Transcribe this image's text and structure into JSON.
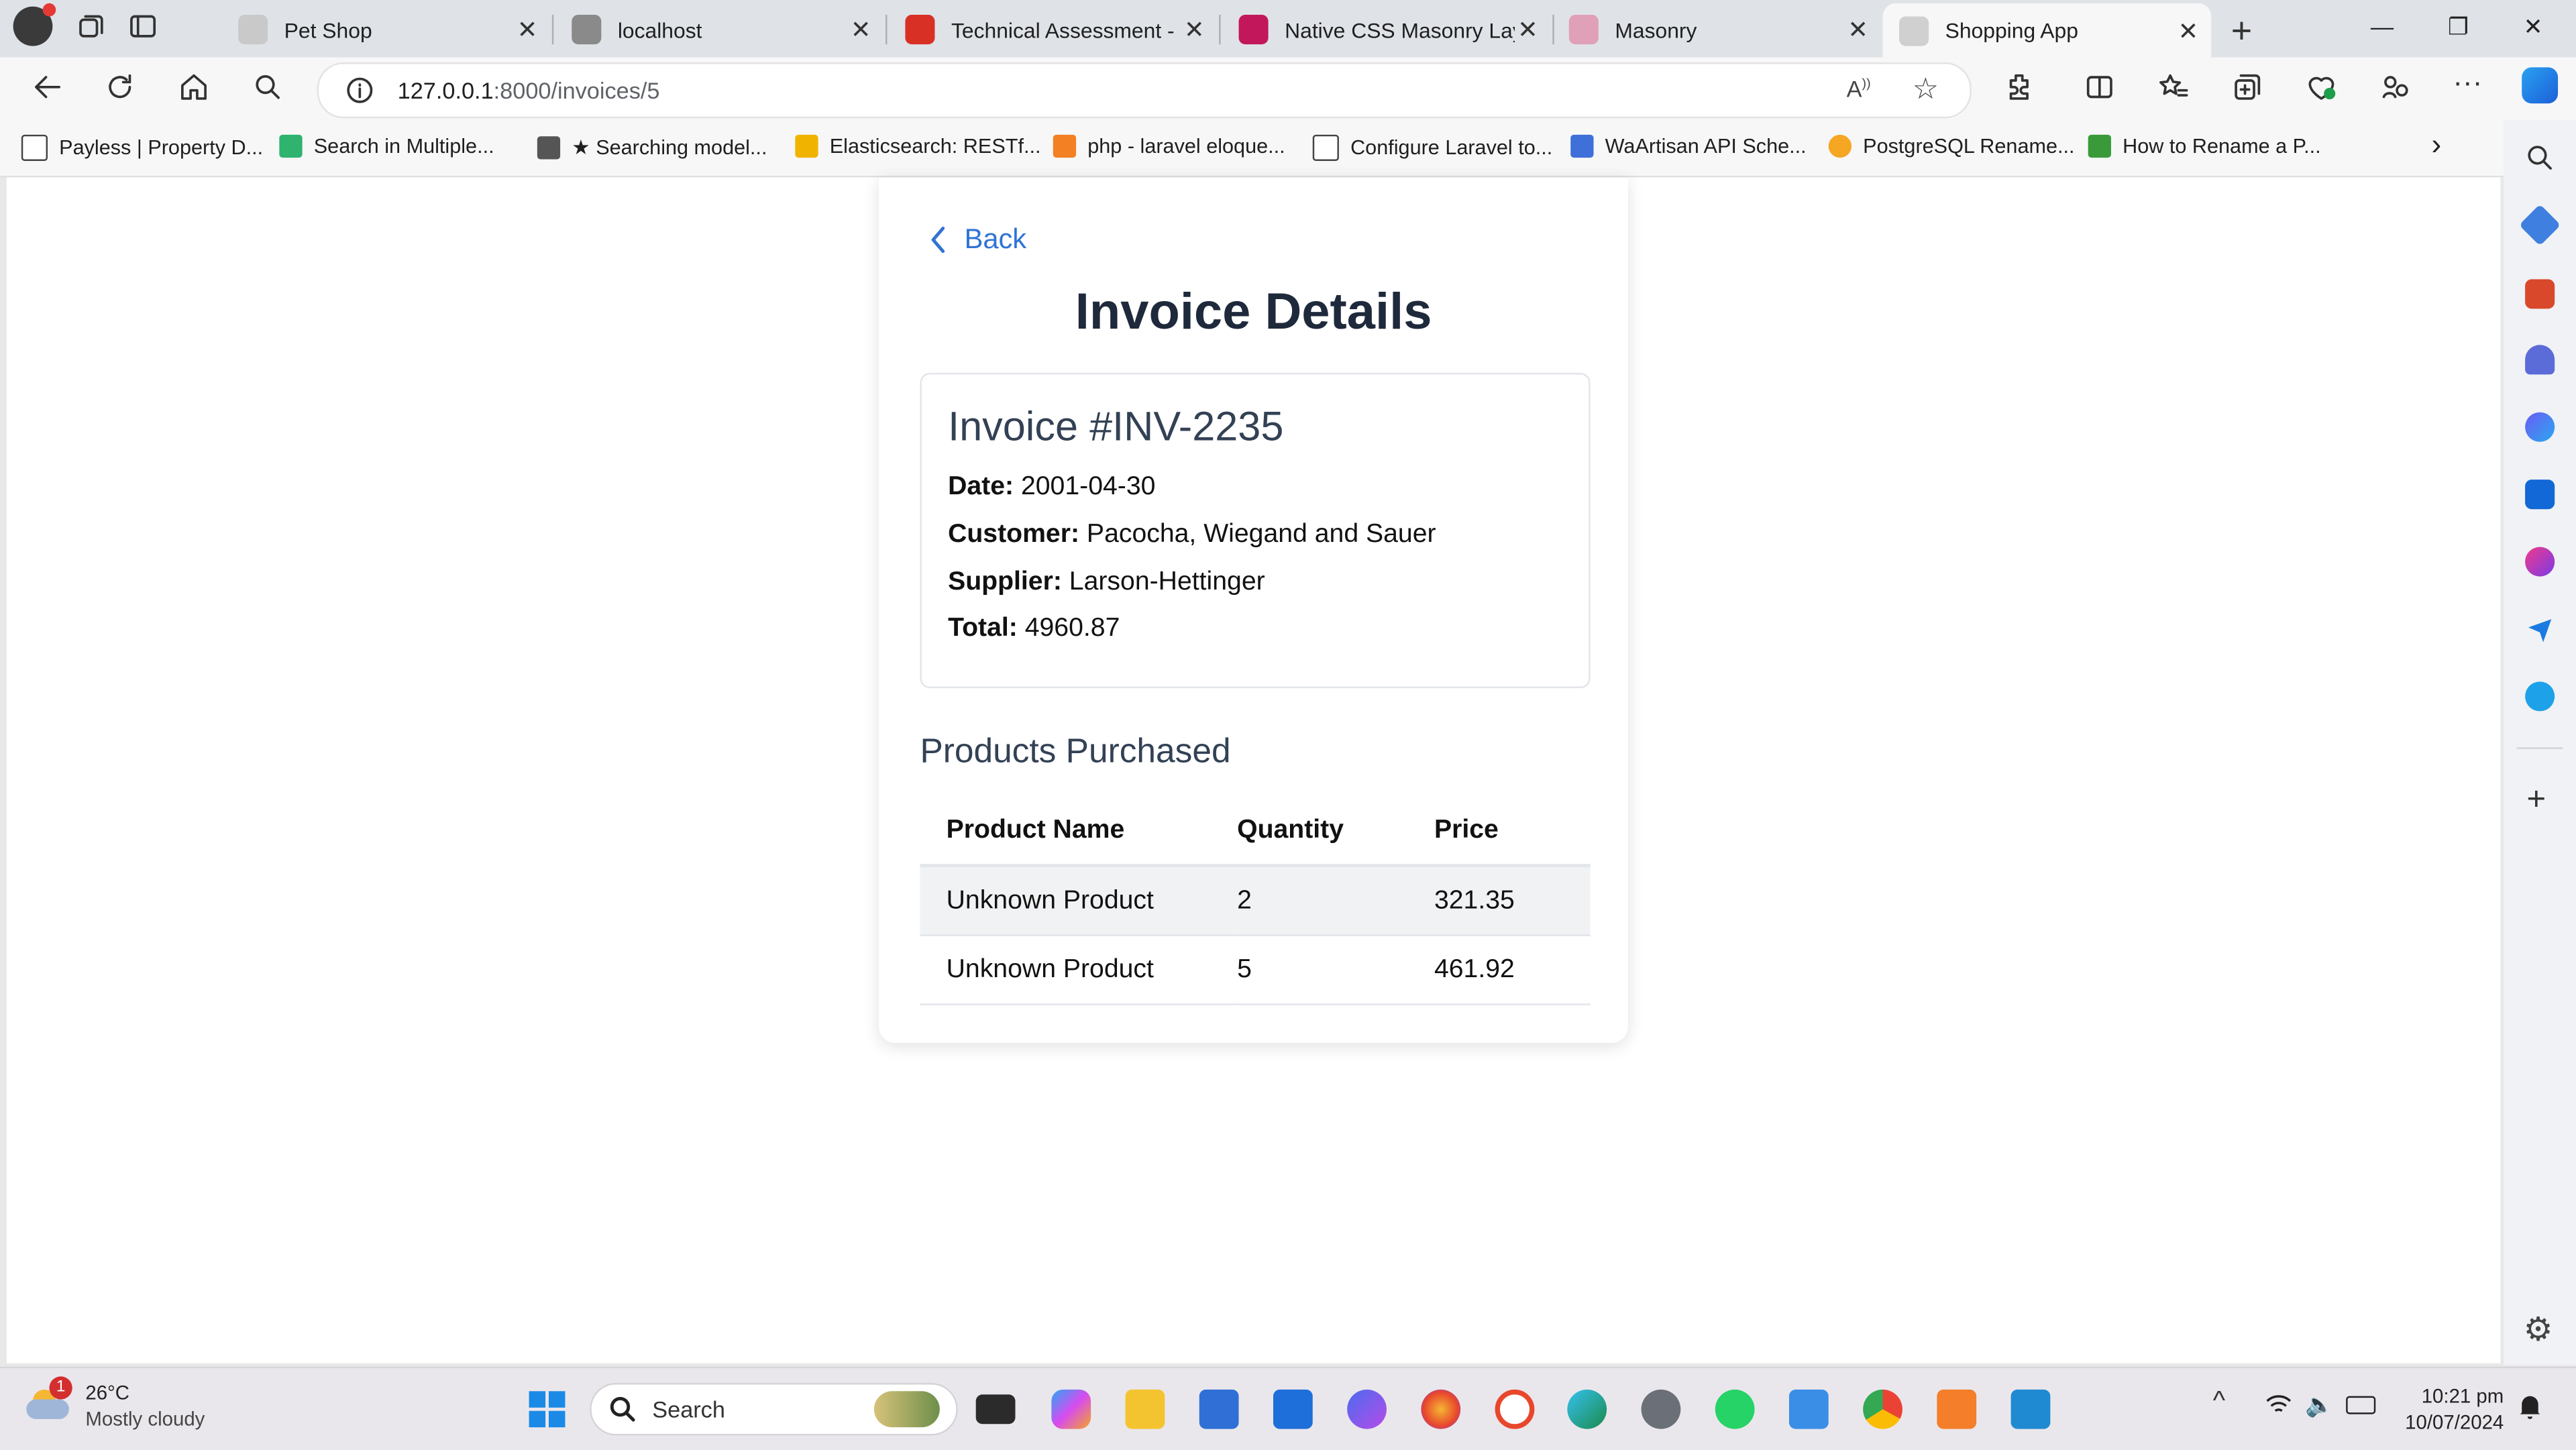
{
  "browser": {
    "tabs": [
      {
        "title": "Pet Shop",
        "favicon_color": "#c9c9c9"
      },
      {
        "title": "localhost",
        "favicon_color": "#8a8a8a"
      },
      {
        "title": "Technical Assessment - S",
        "favicon_color": "#d93025"
      },
      {
        "title": "Native CSS Masonry Layo",
        "favicon_color": "#c2185b"
      },
      {
        "title": "Masonry",
        "favicon_color": "#e0a0b8"
      },
      {
        "title": "Shopping App",
        "favicon_color": "#d0d0d0",
        "active": true
      }
    ],
    "address": {
      "host": "127.0.0.1",
      "path": ":8000/invoices/5"
    },
    "bookmarks": [
      {
        "label": "Payless | Property D...",
        "icon": "page-icon",
        "color": "#ffffff"
      },
      {
        "label": "Search in Multiple...",
        "icon": "grid-icon",
        "color": "#2fb36f"
      },
      {
        "label": "★ Searching model...",
        "icon": "book-icon",
        "color": "#555555"
      },
      {
        "label": "Elasticsearch: RESTf...",
        "icon": "elastic-icon",
        "color": "#f0b400"
      },
      {
        "label": "php - laravel eloque...",
        "icon": "stack-icon",
        "color": "#f48024"
      },
      {
        "label": "Configure Laravel to...",
        "icon": "page-icon",
        "color": "#ffffff"
      },
      {
        "label": "WaArtisan API Sche...",
        "icon": "layers-icon",
        "color": "#3f6fd8"
      },
      {
        "label": "PostgreSQL Rename...",
        "icon": "circle-icon",
        "color": "#f5a623"
      },
      {
        "label": "How to Rename a P...",
        "icon": "leaf-icon",
        "color": "#3a9a3a"
      }
    ]
  },
  "invoice_page": {
    "back_label": "Back",
    "heading": "Invoice Details",
    "invoice_title": "Invoice #INV-2235",
    "fields": [
      {
        "label": "Date:",
        "value": "2001-04-30"
      },
      {
        "label": "Customer:",
        "value": "Pacocha, Wiegand and Sauer"
      },
      {
        "label": "Supplier:",
        "value": "Larson-Hettinger"
      },
      {
        "label": "Total:",
        "value": "4960.87"
      }
    ],
    "products_heading": "Products Purchased",
    "table": {
      "headers": [
        "Product Name",
        "Quantity",
        "Price"
      ],
      "rows": [
        [
          "Unknown Product",
          "2",
          "321.35"
        ],
        [
          "Unknown Product",
          "5",
          "461.92"
        ]
      ]
    }
  },
  "taskbar": {
    "weather_temp": "26°C",
    "weather_desc": "Mostly cloudy",
    "weather_badge": "1",
    "search_placeholder": "Search",
    "time": "10:21 pm",
    "date": "10/07/2024"
  }
}
